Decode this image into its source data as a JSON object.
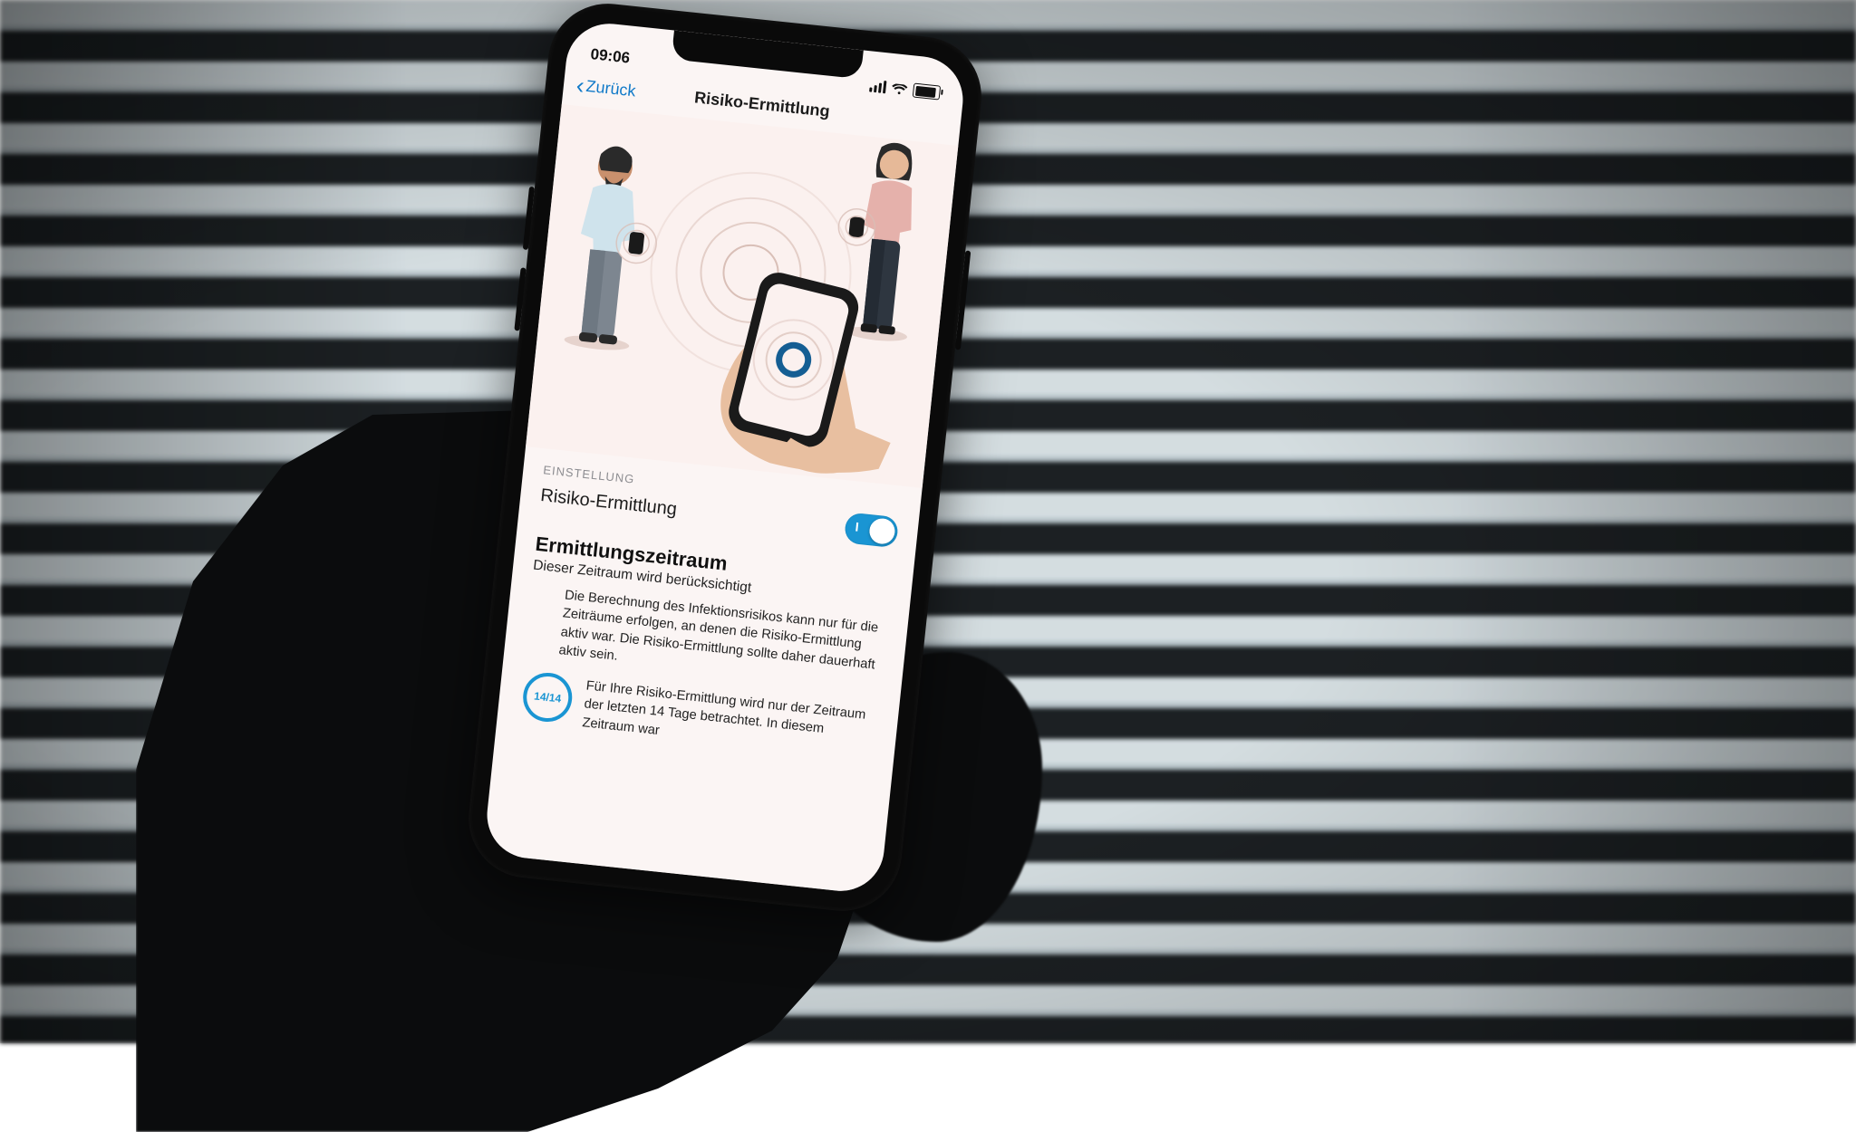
{
  "status": {
    "time": "09:06"
  },
  "nav": {
    "back": "Zurück",
    "title": "Risiko-Ermittlung"
  },
  "settings": {
    "section_label": "EINSTELLUNG",
    "row_label": "Risiko-Ermittlung",
    "toggle_on": true
  },
  "detail": {
    "heading": "Ermittlungszeitraum",
    "subheading": "Dieser Zeitraum wird berücksichtigt",
    "paragraph": "Die Berechnung des Infektionsrisikos kann nur für die Zeiträume erfolgen, an denen die Risiko-Ermittlung aktiv war. Die Risiko-Ermittlung sollte daher dauerhaft aktiv sein.",
    "period_badge": "14/14",
    "period_text": "Für Ihre Risiko-Ermittlung wird nur der Zeitraum der letzten 14 Tage betrachtet. In diesem Zeitraum war"
  }
}
